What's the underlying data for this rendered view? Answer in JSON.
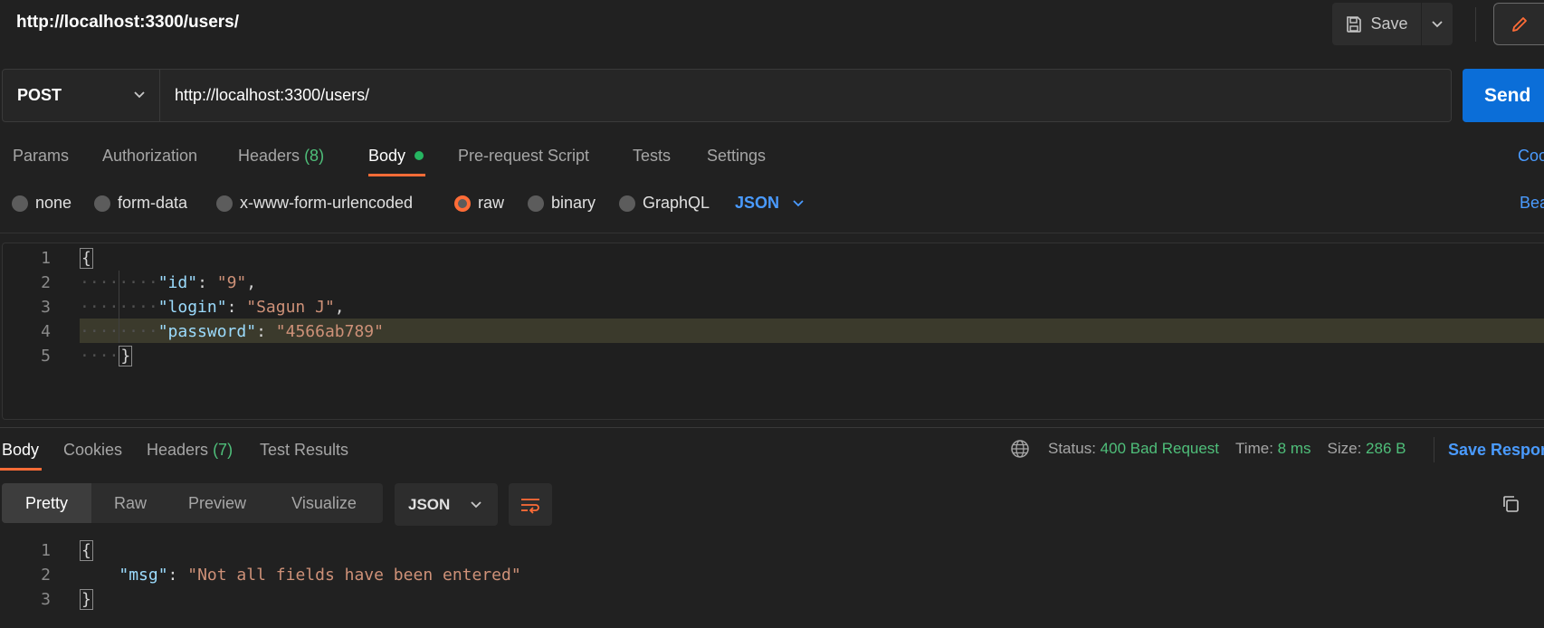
{
  "header": {
    "title": "http://localhost:3300/users/",
    "save_label": "Save"
  },
  "request": {
    "method": "POST",
    "url": "http://localhost:3300/users/",
    "send_label": "Send"
  },
  "request_tabs": {
    "params": "Params",
    "authorization": "Authorization",
    "headers": "Headers",
    "headers_count": "(8)",
    "body": "Body",
    "pre_request": "Pre-request Script",
    "tests": "Tests",
    "settings": "Settings",
    "right_link": "Coo"
  },
  "body_types": {
    "none": "none",
    "form_data": "form-data",
    "urlencoded": "x-www-form-urlencoded",
    "raw": "raw",
    "binary": "binary",
    "graphql": "GraphQL",
    "format": "JSON",
    "right_link": "Bea",
    "selected": "raw"
  },
  "request_body": {
    "line_numbers": [
      "1",
      "2",
      "3",
      "4",
      "5"
    ],
    "open_brace": "{",
    "close_brace": "}",
    "fields": [
      {
        "key": "\"id\"",
        "value": "\"9\"",
        "trail": ","
      },
      {
        "key": "\"login\"",
        "value": "\"Sagun J\"",
        "trail": ","
      },
      {
        "key": "\"password\"",
        "value": "\"4566ab789\"",
        "trail": ""
      }
    ]
  },
  "response_tabs": {
    "body": "Body",
    "cookies": "Cookies",
    "headers": "Headers",
    "headers_count": "(7)",
    "test_results": "Test Results"
  },
  "response_status": {
    "status_label": "Status:",
    "status_value": "400 Bad Request",
    "time_label": "Time:",
    "time_value": "8 ms",
    "size_label": "Size:",
    "size_value": "286 B",
    "save_response": "Save Respor"
  },
  "response_view": {
    "pretty": "Pretty",
    "raw": "Raw",
    "preview": "Preview",
    "visualize": "Visualize",
    "format": "JSON"
  },
  "response_body": {
    "line_numbers": [
      "1",
      "2",
      "3"
    ],
    "open_brace": "{",
    "close_brace": "}",
    "key": "\"msg\"",
    "value": "\"Not all fields have been entered\""
  },
  "colors": {
    "accent": "#ff6c37",
    "send": "#0b6ed8",
    "link": "#4a9bff",
    "success": "#4fbf7a"
  }
}
